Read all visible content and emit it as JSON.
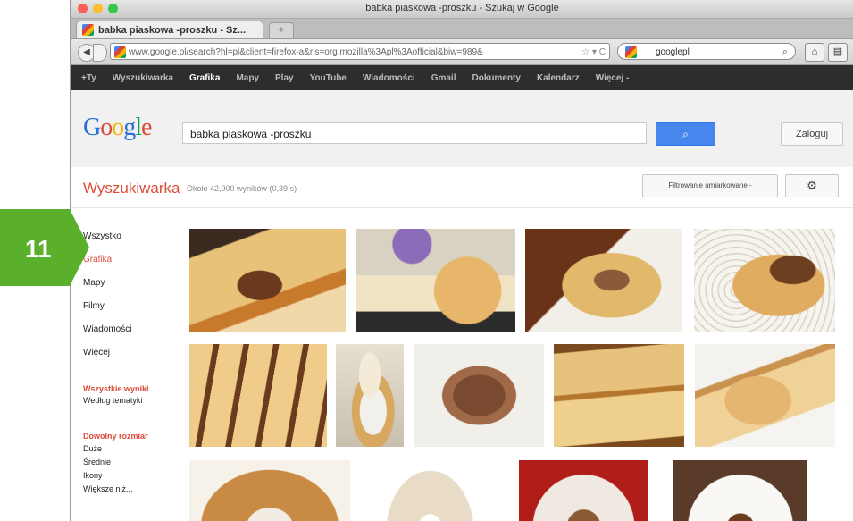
{
  "window": {
    "title": "babka piaskowa -proszku - Szukaj w Google"
  },
  "tab": {
    "label": "babka piaskowa -proszku - Sz..."
  },
  "new_tab_symbol": "+",
  "toolbar": {
    "url": "www.google.pl/search?hl=pl&client=firefox-a&rls=org.mozilla%3Apl%3Aofficial&biw=989&",
    "search_engine_value": "googlepl"
  },
  "google_bar": {
    "items": [
      {
        "label": "+Ty",
        "active": false
      },
      {
        "label": "Wyszukiwarka",
        "active": false
      },
      {
        "label": "Grafika",
        "active": true
      },
      {
        "label": "Mapy",
        "active": false
      },
      {
        "label": "Play",
        "active": false
      },
      {
        "label": "YouTube",
        "active": false
      },
      {
        "label": "Wiadomości",
        "active": false
      },
      {
        "label": "Gmail",
        "active": false
      },
      {
        "label": "Dokumenty",
        "active": false
      },
      {
        "label": "Kalendarz",
        "active": false
      },
      {
        "label": "Więcej -",
        "active": false
      }
    ]
  },
  "search": {
    "logo": "Google",
    "query": "babka piaskowa -proszku",
    "login_label": "Zaloguj"
  },
  "results": {
    "section_title": "Wyszukiwarka",
    "count_text": "Około 42,900 wyników (0,39 s)",
    "filter_label": "Filtrowanie umiarkowane -"
  },
  "left_nav": {
    "items": [
      "Wszystko",
      "Grafika",
      "Mapy",
      "Filmy",
      "Wiadomości",
      "Więcej"
    ],
    "all_results": "Wszystkie wyniki",
    "by_topic": "Według tematyki",
    "size_head": "Dowolny rozmiar",
    "sizes": [
      "Duże",
      "Średnie",
      "Ikony",
      "Większe niż..."
    ]
  },
  "badge": {
    "number": "11",
    "color": "#5aaf2b"
  },
  "colors": {
    "google_red": "#dd4b39",
    "google_blue": "#4787ed",
    "bar_dark": "#2d2d2d"
  },
  "images": [
    {
      "name": "marble-cake-slice-on-plate"
    },
    {
      "name": "bundt-cake-slices-with-flowers"
    },
    {
      "name": "marble-loaf-slices"
    },
    {
      "name": "marble-cake-on-doily"
    },
    {
      "name": "loaf-slices-close-up"
    },
    {
      "name": "glazed-bundt-slice"
    },
    {
      "name": "chocolate-bundt-cake"
    },
    {
      "name": "sponge-loaf-cut"
    },
    {
      "name": "sliced-cake-on-board"
    },
    {
      "name": "bundt-cake-ring"
    },
    {
      "name": "sugar-dusted-bundt"
    },
    {
      "name": "bundt-on-red-plate"
    },
    {
      "name": "white-glazed-bundt"
    }
  ]
}
